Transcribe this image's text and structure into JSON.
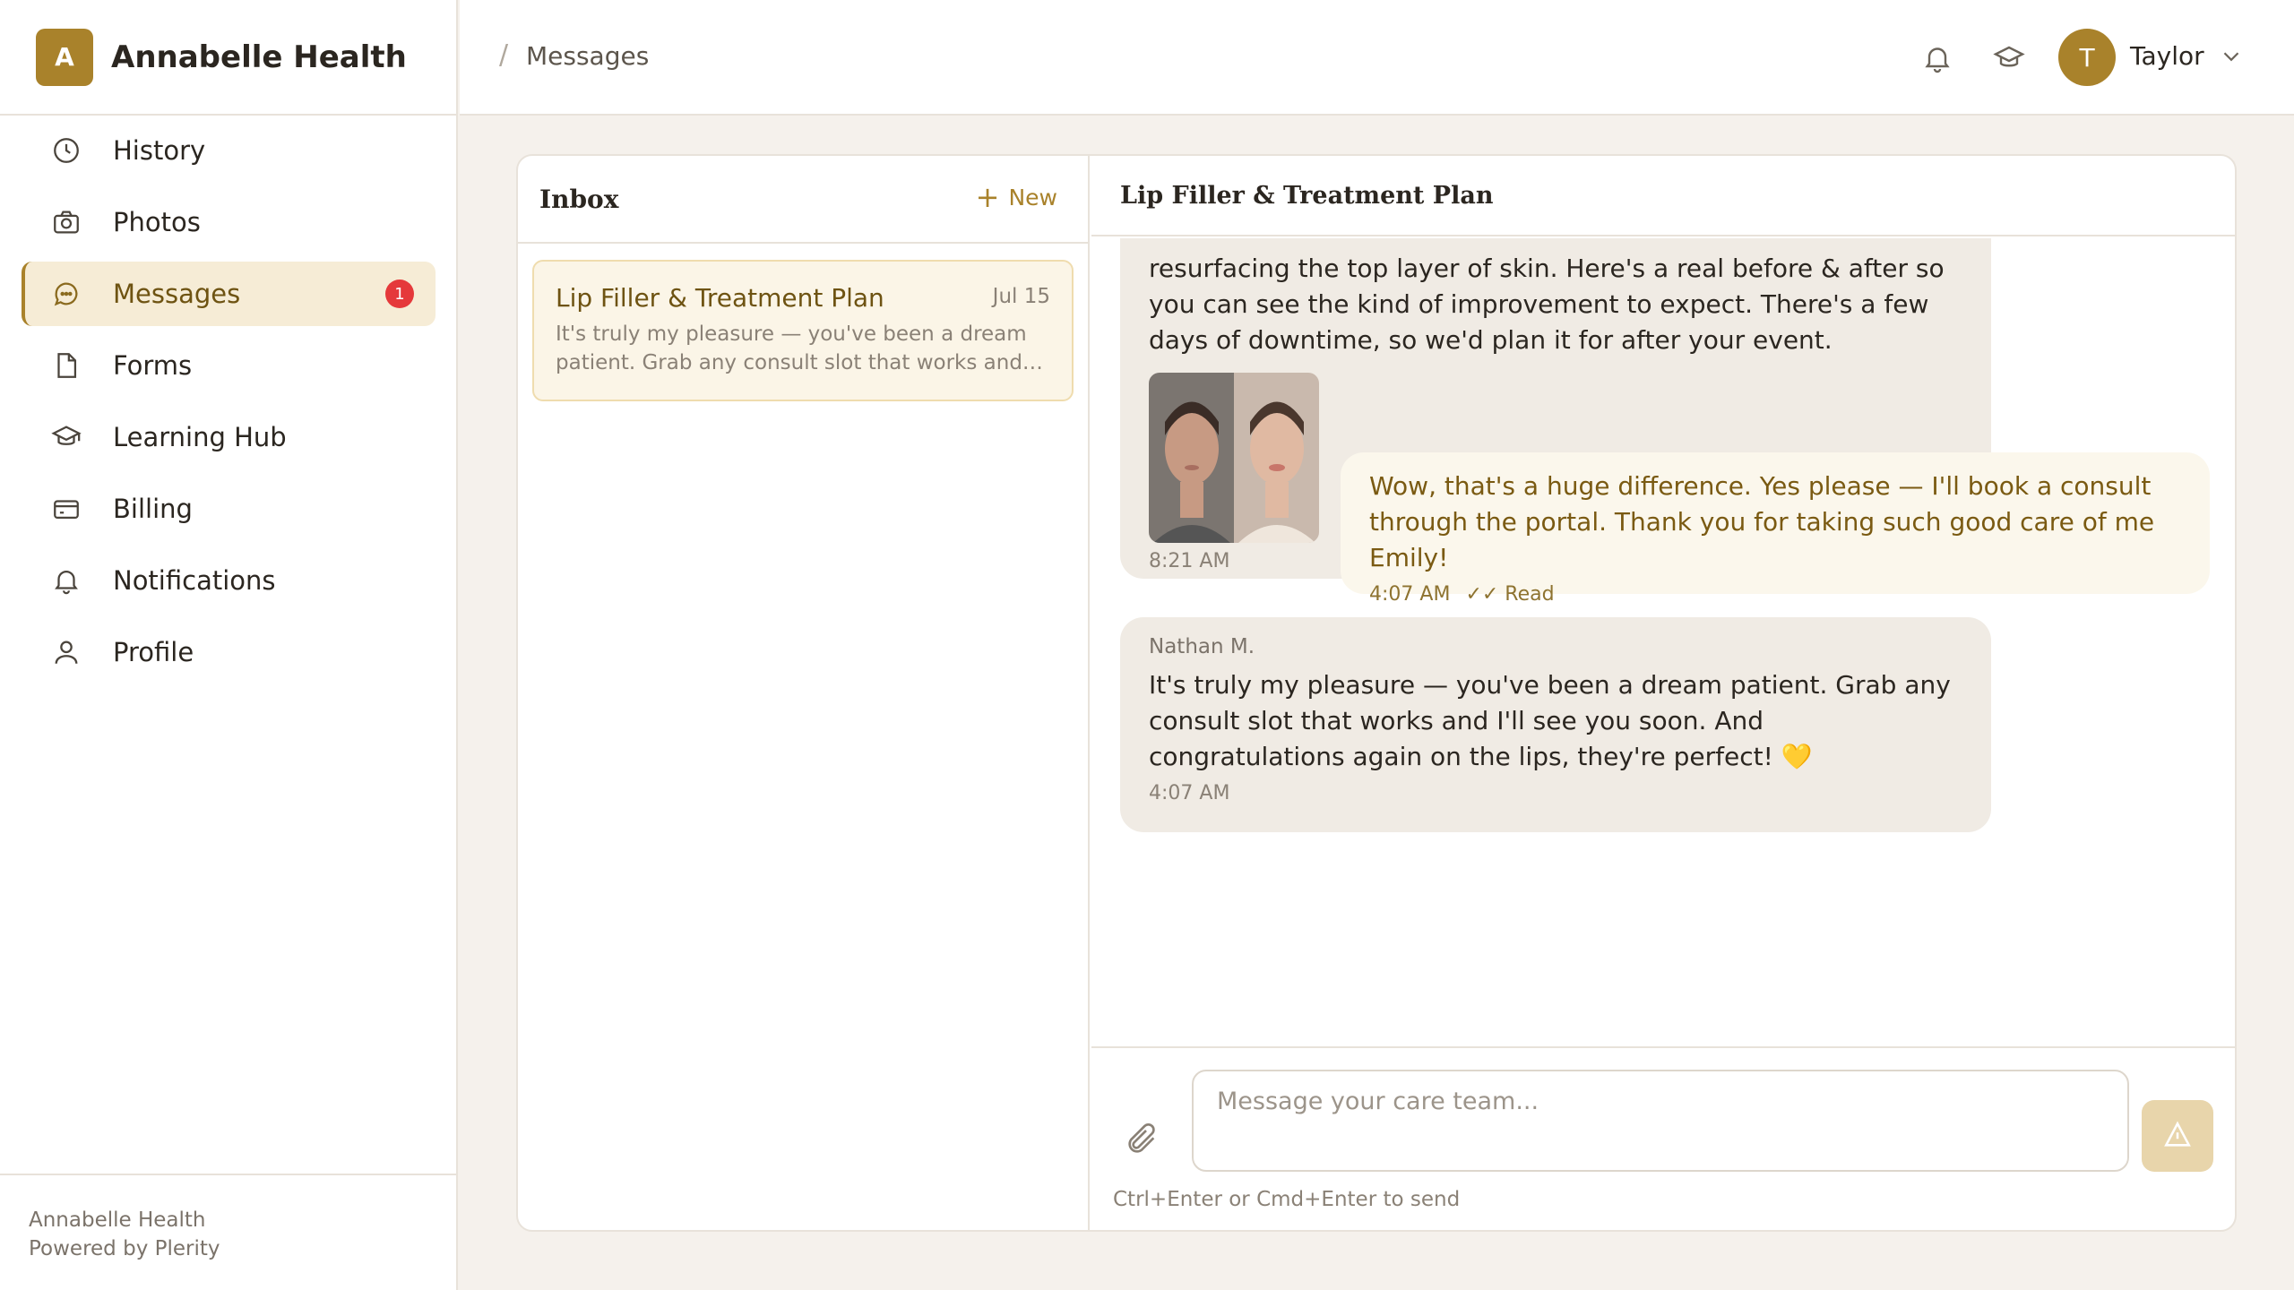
{
  "brand": {
    "logo_letter": "A",
    "name": "Annabelle Health"
  },
  "sidebar": {
    "items": [
      {
        "label": "History",
        "icon": "clock-icon"
      },
      {
        "label": "Photos",
        "icon": "camera-icon"
      },
      {
        "label": "Messages",
        "icon": "chat-icon",
        "badge": "1",
        "active": true
      },
      {
        "label": "Forms",
        "icon": "document-icon"
      },
      {
        "label": "Learning Hub",
        "icon": "graduation-cap-icon"
      },
      {
        "label": "Billing",
        "icon": "wallet-icon"
      },
      {
        "label": "Notifications",
        "icon": "bell-icon"
      },
      {
        "label": "Profile",
        "icon": "user-icon"
      }
    ],
    "footer": {
      "line1": "Annabelle Health",
      "line2": "Powered by Plerity"
    }
  },
  "topbar": {
    "breadcrumb_sep": "/",
    "breadcrumb": "Messages",
    "user": {
      "initial": "T",
      "name": "Taylor"
    }
  },
  "inbox": {
    "title": "Inbox",
    "new_label": "New",
    "threads": [
      {
        "title": "Lip Filler & Treatment Plan",
        "date": "Jul 15",
        "preview": "It's truly my pleasure — you've been a dream patient. Grab any consult slot that works and…"
      }
    ]
  },
  "conversation": {
    "title": "Lip Filler & Treatment Plan",
    "messages": [
      {
        "direction": "in",
        "text": "resurfacing the top layer of skin. Here's a real before & after so you can see the kind of improvement to expect. There's a few days of downtime, so we'd plan it for after your event.",
        "time": "8:21 AM"
      },
      {
        "direction": "out",
        "text": "Wow, that's a huge difference. Yes please — I'll book a consult through the portal. Thank you for taking such good care of me Emily!",
        "time": "4:07 AM",
        "status": "✓✓ Read"
      },
      {
        "direction": "in",
        "sender": "Nathan M.",
        "text": "It's truly my pleasure — you've been a dream patient. Grab any consult slot that works and I'll see you soon. And congratulations again on the lips, they're perfect! 💛",
        "time": "4:07 AM"
      }
    ],
    "composer": {
      "placeholder": "Message your care team...",
      "hint": "Ctrl+Enter or Cmd+Enter to send"
    }
  },
  "colors": {
    "accent": "#a9822b",
    "badge": "#e5393b",
    "active_bg": "#f6ecd6"
  }
}
